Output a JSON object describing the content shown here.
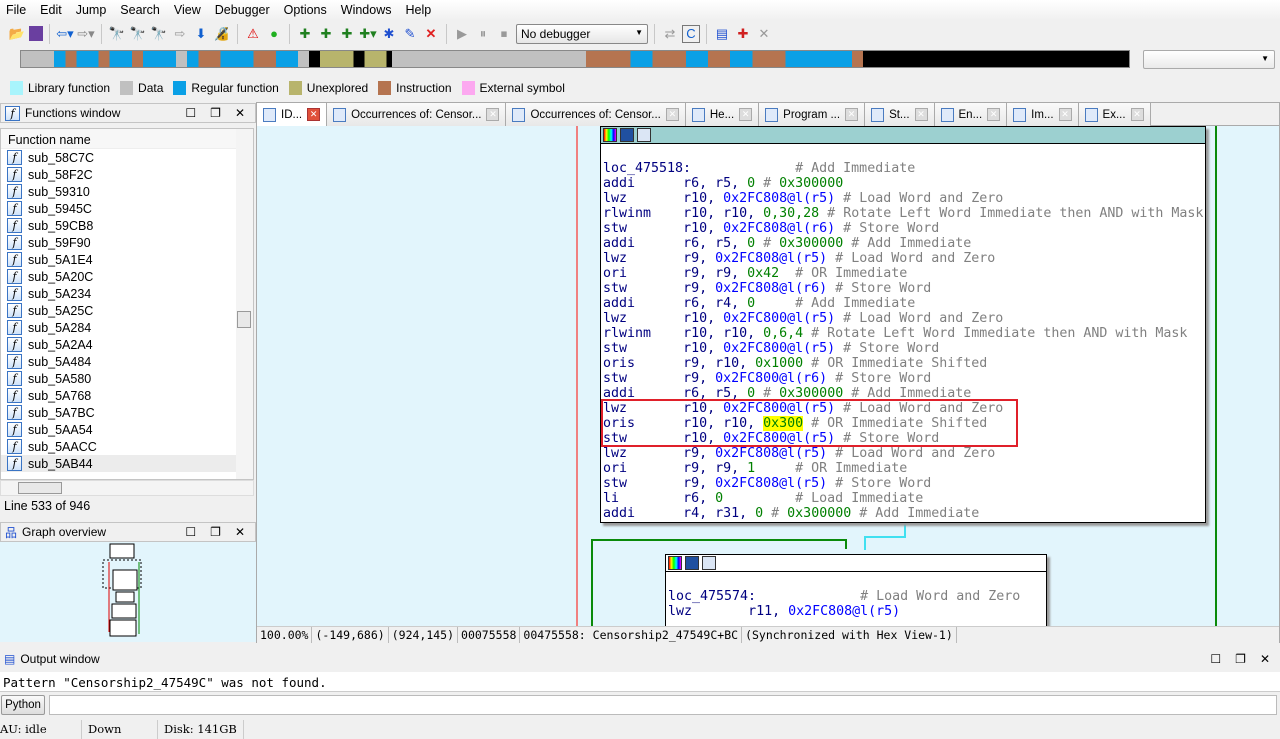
{
  "menu": [
    "File",
    "Edit",
    "Jump",
    "Search",
    "View",
    "Debugger",
    "Options",
    "Windows",
    "Help"
  ],
  "toolbar": {
    "debugger_select": "No debugger"
  },
  "legend": [
    {
      "label": "Library function",
      "color": "#a8f4fc"
    },
    {
      "label": "Data",
      "color": "#c0c0c0"
    },
    {
      "label": "Regular function",
      "color": "#0aa0e6"
    },
    {
      "label": "Unexplored",
      "color": "#b8b46c"
    },
    {
      "label": "Instruction",
      "color": "#b57450"
    },
    {
      "label": "External symbol",
      "color": "#fca8f0"
    }
  ],
  "functions_window": {
    "title": "Functions window",
    "column": "Function name",
    "items": [
      "sub_58C7C",
      "sub_58F2C",
      "sub_59310",
      "sub_5945C",
      "sub_59CB8",
      "sub_59F90",
      "sub_5A1E4",
      "sub_5A20C",
      "sub_5A234",
      "sub_5A25C",
      "sub_5A284",
      "sub_5A2A4",
      "sub_5A484",
      "sub_5A580",
      "sub_5A768",
      "sub_5A7BC",
      "sub_5AA54",
      "sub_5AACC",
      "sub_5AB44"
    ],
    "selected": "sub_5AB44",
    "line_status": "Line 533 of 946"
  },
  "graph_overview": {
    "title": "Graph overview"
  },
  "tabs": [
    {
      "label": "ID...",
      "active": true
    },
    {
      "label": "Occurrences of: Censor..."
    },
    {
      "label": "Occurrences of: Censor..."
    },
    {
      "label": "He..."
    },
    {
      "label": "Program ..."
    },
    {
      "label": "St..."
    },
    {
      "label": "En..."
    },
    {
      "label": "Im..."
    },
    {
      "label": "Ex..."
    }
  ],
  "block1": [
    [
      [
        "loc_475518:             ",
        "r"
      ],
      [
        "# Add Immediate",
        "c"
      ]
    ],
    [
      [
        "addi      ",
        "m"
      ],
      [
        "r6, r5, ",
        "r"
      ],
      [
        "0",
        "n"
      ],
      [
        " # ",
        "c"
      ],
      [
        "0x300000",
        "n"
      ]
    ],
    [
      [
        "lwz       ",
        "m"
      ],
      [
        "r10, ",
        "r"
      ],
      [
        "0x2FC808@l(r5)",
        "a"
      ],
      [
        " # Load Word and Zero",
        "c"
      ]
    ],
    [
      [
        "rlwinm    ",
        "m"
      ],
      [
        "r10, r10, ",
        "r"
      ],
      [
        "0,30,28",
        "n"
      ],
      [
        " # Rotate Left Word Immediate then AND with Mask",
        "c"
      ]
    ],
    [
      [
        "stw       ",
        "m"
      ],
      [
        "r10, ",
        "r"
      ],
      [
        "0x2FC808@l(r6)",
        "a"
      ],
      [
        " # Store Word",
        "c"
      ]
    ],
    [
      [
        "addi      ",
        "m"
      ],
      [
        "r6, r5, ",
        "r"
      ],
      [
        "0",
        "n"
      ],
      [
        " # ",
        "c"
      ],
      [
        "0x300000",
        "n"
      ],
      [
        " # Add Immediate",
        "c"
      ]
    ],
    [
      [
        "lwz       ",
        "m"
      ],
      [
        "r9, ",
        "r"
      ],
      [
        "0x2FC808@l(r5)",
        "a"
      ],
      [
        " # Load Word and Zero",
        "c"
      ]
    ],
    [
      [
        "ori       ",
        "m"
      ],
      [
        "r9, r9, ",
        "r"
      ],
      [
        "0x42",
        "n"
      ],
      [
        "  # OR Immediate",
        "c"
      ]
    ],
    [
      [
        "stw       ",
        "m"
      ],
      [
        "r9, ",
        "r"
      ],
      [
        "0x2FC808@l(r6)",
        "a"
      ],
      [
        " # Store Word",
        "c"
      ]
    ],
    [
      [
        "addi      ",
        "m"
      ],
      [
        "r6, r4, ",
        "r"
      ],
      [
        "0",
        "n"
      ],
      [
        "     # Add Immediate",
        "c"
      ]
    ],
    [
      [
        "lwz       ",
        "m"
      ],
      [
        "r10, ",
        "r"
      ],
      [
        "0x2FC800@l(r5)",
        "a"
      ],
      [
        " # Load Word and Zero",
        "c"
      ]
    ],
    [
      [
        "rlwinm    ",
        "m"
      ],
      [
        "r10, r10, ",
        "r"
      ],
      [
        "0,6,4",
        "n"
      ],
      [
        " # Rotate Left Word Immediate then AND with Mask",
        "c"
      ]
    ],
    [
      [
        "stw       ",
        "m"
      ],
      [
        "r10, ",
        "r"
      ],
      [
        "0x2FC800@l(r5)",
        "a"
      ],
      [
        " # Store Word",
        "c"
      ]
    ],
    [
      [
        "oris      ",
        "m"
      ],
      [
        "r9, r10, ",
        "r"
      ],
      [
        "0x1000",
        "n"
      ],
      [
        " # OR Immediate Shifted",
        "c"
      ]
    ],
    [
      [
        "stw       ",
        "m"
      ],
      [
        "r9, ",
        "r"
      ],
      [
        "0x2FC800@l(r6)",
        "a"
      ],
      [
        " # Store Word",
        "c"
      ]
    ],
    [
      [
        "addi      ",
        "m"
      ],
      [
        "r6, r5, ",
        "r"
      ],
      [
        "0",
        "n"
      ],
      [
        " # ",
        "c"
      ],
      [
        "0x300000",
        "n"
      ],
      [
        " # Add Immediate",
        "c"
      ]
    ],
    [
      [
        "lwz       ",
        "m"
      ],
      [
        "r10, ",
        "r"
      ],
      [
        "0x2FC800@l(r5)",
        "a"
      ],
      [
        " # Load Word and Zero",
        "c"
      ]
    ],
    [
      [
        "oris      ",
        "m"
      ],
      [
        "r10, r10, ",
        "r"
      ],
      [
        "0x300",
        "h"
      ],
      [
        " # OR Immediate Shifted",
        "c"
      ]
    ],
    [
      [
        "stw       ",
        "m"
      ],
      [
        "r10, ",
        "r"
      ],
      [
        "0x2FC800@l(r5)",
        "a"
      ],
      [
        " # Store Word",
        "c"
      ]
    ],
    [
      [
        "lwz       ",
        "m"
      ],
      [
        "r9, ",
        "r"
      ],
      [
        "0x2FC808@l(r5)",
        "a"
      ],
      [
        " # Load Word and Zero",
        "c"
      ]
    ],
    [
      [
        "ori       ",
        "m"
      ],
      [
        "r9, r9, ",
        "r"
      ],
      [
        "1",
        "n"
      ],
      [
        "     # OR Immediate",
        "c"
      ]
    ],
    [
      [
        "stw       ",
        "m"
      ],
      [
        "r9, ",
        "r"
      ],
      [
        "0x2FC808@l(r5)",
        "a"
      ],
      [
        " # Store Word",
        "c"
      ]
    ],
    [
      [
        "li        ",
        "m"
      ],
      [
        "r6, ",
        "r"
      ],
      [
        "0",
        "n"
      ],
      [
        "         # Load Immediate",
        "c"
      ]
    ],
    [
      [
        "addi      ",
        "m"
      ],
      [
        "r4, r31, ",
        "r"
      ],
      [
        "0",
        "n"
      ],
      [
        " # ",
        "c"
      ],
      [
        "0x300000",
        "n"
      ],
      [
        " # Add Immediate",
        "c"
      ]
    ]
  ],
  "block2": [
    [
      [
        "loc_475574:             ",
        "r"
      ],
      [
        "# Load Word and Zero",
        "c"
      ]
    ],
    [
      [
        "lwz       ",
        "m"
      ],
      [
        "r11, ",
        "r"
      ],
      [
        "0x2FC808@l(r5)",
        "a"
      ]
    ]
  ],
  "status": [
    "100.00%",
    "(-149,686)",
    "(924,145)",
    "00075558",
    "00475558: Censorship2_47549C+BC",
    "(Synchronized with Hex View-1)"
  ],
  "output": {
    "title": "Output window",
    "text": "Pattern \"Censorship2_47549C\" was not found.",
    "python_button": "Python"
  },
  "bottom": {
    "au": "AU:  idle",
    "dir": "Down",
    "disk": "Disk: 141GB"
  }
}
